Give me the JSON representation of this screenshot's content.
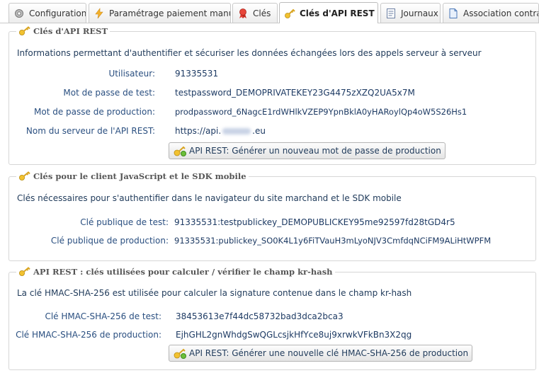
{
  "tabs": [
    {
      "label": "Configuration",
      "icon": "gear-icon"
    },
    {
      "label": "Paramétrage paiement manuel",
      "icon": "lightning-icon"
    },
    {
      "label": "Clés",
      "icon": "ribbon-icon"
    },
    {
      "label": "Clés d'API REST",
      "icon": "key-icon",
      "active": true
    },
    {
      "label": "Journaux",
      "icon": "log-icon"
    },
    {
      "label": "Association contrats",
      "icon": "document-icon"
    }
  ],
  "api_rest": {
    "title": "Clés d'API REST",
    "description": "Informations permettant d'authentifier et sécuriser les données échangées lors des appels serveur à serveur",
    "rows": [
      {
        "label": "Utilisateur:",
        "value": "91335531"
      },
      {
        "label": "Mot de passe de test:",
        "value": "testpassword_DEMOPRIVATEKEY23G4475zXZQ2UA5x7M"
      },
      {
        "label": "Mot de passe de production:",
        "value": "prodpassword_6NagcE1rdWHlkVZEP9YpnBklA0yHARoylQp4oW5S26Hs1"
      },
      {
        "label": "Nom du serveur de l'API REST:",
        "value": "https://api."
      }
    ],
    "server_suffix": ".eu",
    "button": "API REST: Générer un nouveau mot de passe de production"
  },
  "js_sdk": {
    "title": "Clés pour le client JavaScript et le SDK mobile",
    "description": "Clés nécessaires pour s'authentifier dans le navigateur du site marchand et le SDK mobile",
    "rows": [
      {
        "label": "Clé publique de test:",
        "value": "91335531:testpublickey_DEMOPUBLICKEY95me92597fd28tGD4r5"
      },
      {
        "label": "Clé publique de production:",
        "value": "91335531:publickey_SO0K4L1y6FiTVauH3mLyoNJV3CmfdqNCiFM9ALiHtWPFM"
      }
    ]
  },
  "hmac": {
    "title": "API REST : clés utilisées pour calculer / vérifier le champ kr-hash",
    "description": "La clé HMAC-SHA-256 est utilisée pour calculer la signature contenue dans le champ kr-hash",
    "rows": [
      {
        "label": "Clé HMAC-SHA-256 de test:",
        "value": "38453613e7f44dc58732bad3dca2bca3"
      },
      {
        "label": "Clé HMAC-SHA-256 de production:",
        "value": "EjhGHL2gnWhdgSwQGLcsjkHfYce8uj9xrwkVFkBn3X2qg"
      }
    ],
    "button": "API REST: Générer une nouvelle clé HMAC-SHA-256 de production"
  }
}
